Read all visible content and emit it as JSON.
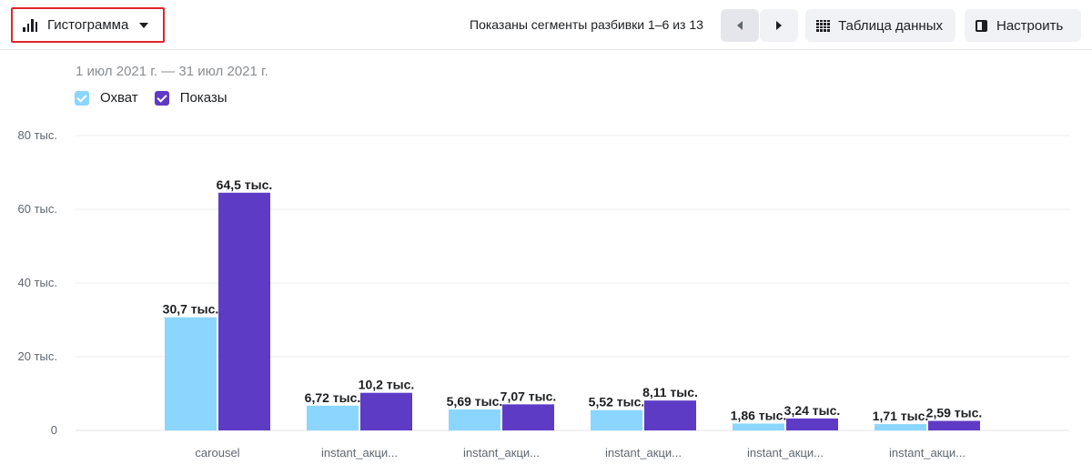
{
  "toolbar": {
    "chart_type_label": "Гистограмма",
    "segments_text": "Показаны сегменты разбивки 1–6 из 13",
    "data_table_label": "Таблица данных",
    "settings_label": "Настроить"
  },
  "date_range": "1 июл 2021 г. — 31 июл 2021 г.",
  "colors": {
    "reach": "#8bd6ff",
    "impressions": "#5e3bc5",
    "highlight": "#e0242b"
  },
  "chart_data": {
    "type": "bar",
    "categories": [
      "carousel",
      "instant_акци...",
      "instant_акци...",
      "instant_акци...",
      "instant_акци...",
      "instant_акци..."
    ],
    "series": [
      {
        "name": "Охват",
        "values": [
          30700,
          6720,
          5690,
          5520,
          1860,
          1710
        ],
        "labels": [
          "30,7 тыс.",
          "6,72 тыс.",
          "5,69 тыс.",
          "5,52 тыс.",
          "1,86 тыс.",
          "1,71 тыс."
        ]
      },
      {
        "name": "Показы",
        "values": [
          64500,
          10200,
          7070,
          8110,
          3240,
          2590
        ],
        "labels": [
          "64,5 тыс.",
          "10,2 тыс.",
          "7,07 тыс.",
          "8,11 тыс.",
          "3,24 тыс.",
          "2,59 тыс."
        ]
      }
    ],
    "yticks": [
      {
        "value": 0,
        "label": "0"
      },
      {
        "value": 20000,
        "label": "20 тыс."
      },
      {
        "value": 40000,
        "label": "40 тыс."
      },
      {
        "value": 60000,
        "label": "60 тыс."
      },
      {
        "value": 80000,
        "label": "80 тыс."
      }
    ],
    "ylim": [
      0,
      80000
    ],
    "grid": true,
    "legend_position": "top-left"
  }
}
